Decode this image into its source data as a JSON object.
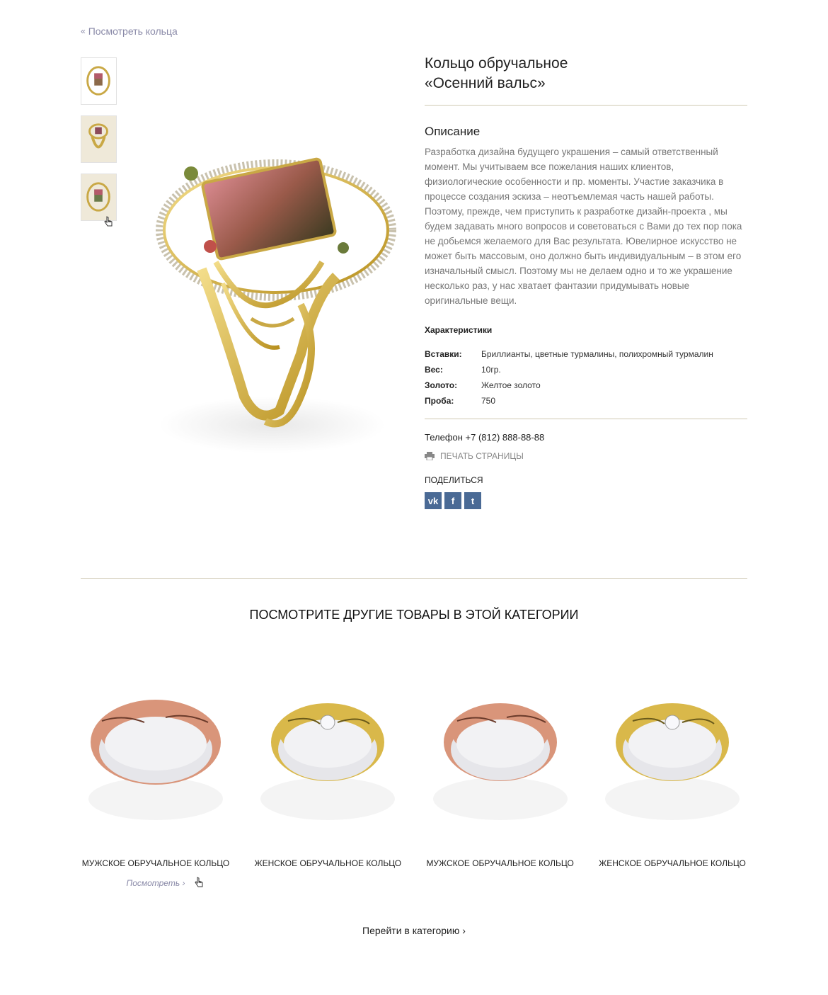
{
  "nav": {
    "back_label": "Посмотреть кольца"
  },
  "product": {
    "title_line1": "Кольцо обручальное",
    "title_line2": "«Осенний вальс»",
    "description_title": "Описание",
    "description": "Разработка дизайна будущего украшения – самый ответственный момент. Мы учитываем все пожелания наших клиентов, физиологические особенности и пр. моменты. Участие заказчика в процессе создания эскиза – неотъемлемая часть нашей работы. Поэтому, прежде, чем приступить  к разработке дизайн-проекта , мы будем задавать много вопросов и советоваться с Вами до тех пор пока не добьемся желаемого для Вас результата. Ювелирное искусство не может быть массовым, оно должно быть индивидуальным – в этом его изначальный смысл. Поэтому мы не делаем одно и то же украшение несколько раз, у нас хватает фантазии придумывать новые оригинальные вещи.",
    "specs_title": "Характеристики",
    "specs": [
      {
        "key": "Вставки:",
        "value": "Бриллианты, цветные турмалины, полихромный турмалин"
      },
      {
        "key": "Вес:",
        "value": "10гр."
      },
      {
        "key": "Золото:",
        "value": "Желтое золото"
      },
      {
        "key": "Проба:",
        "value": "750"
      }
    ],
    "phone": "Телефон +7 (812) 888-88-88",
    "print_label": "ПЕЧАТЬ СТРАНИЦЫ",
    "share_label": "ПОДЕЛИТЬСЯ",
    "share_buttons": [
      "vk",
      "f",
      "t"
    ]
  },
  "related": {
    "title": "ПОСМОТРИТЕ ДРУГИЕ ТОВАРЫ В ЭТОЙ КАТЕГОРИИ",
    "items": [
      {
        "name": "МУЖСКОЕ ОБРУЧАЛЬНОЕ КОЛЬЦО",
        "more": "Посмотреть ›"
      },
      {
        "name": "ЖЕНСКОЕ ОБРУЧАЛЬНОЕ КОЛЬЦО"
      },
      {
        "name": "МУЖСКОЕ ОБРУЧАЛЬНОЕ КОЛЬЦО"
      },
      {
        "name": "ЖЕНСКОЕ ОБРУЧАЛЬНОЕ КОЛЬЦО"
      }
    ],
    "category_link": "Перейти в категорию  ›"
  },
  "colors": {
    "accent_link": "#8a8aa8",
    "divider": "#cfc9b4",
    "share_bg": "#4a6a95",
    "gold": "#d9b84a",
    "rose_gold": "#d9957a"
  }
}
